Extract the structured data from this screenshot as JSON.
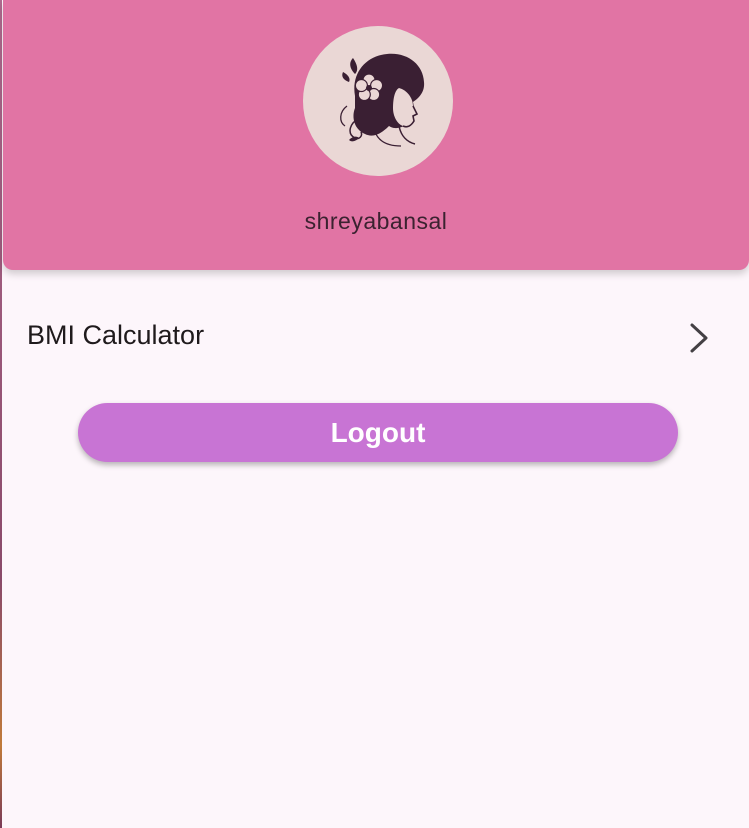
{
  "profile": {
    "username": "shreyabansal",
    "avatar_icon": "woman-flower-portrait-icon"
  },
  "menu": {
    "items": [
      {
        "label": "BMI Calculator",
        "icon": "chevron-right-icon"
      }
    ]
  },
  "actions": {
    "logout_label": "Logout"
  },
  "colors": {
    "header_bg": "#e174a4",
    "avatar_bg": "#ead7d5",
    "page_bg": "#fdf6fb",
    "button_bg": "#c874d4",
    "button_text": "#ffffff"
  }
}
